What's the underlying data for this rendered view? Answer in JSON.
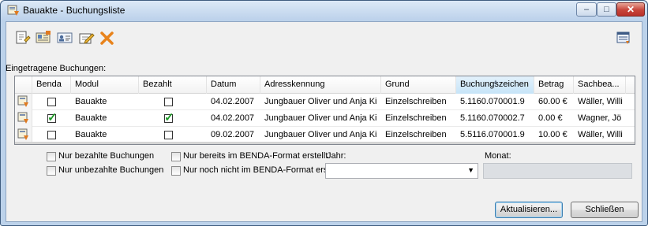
{
  "window": {
    "title": "Bauakte - Buchungsliste",
    "controls": {
      "minimize": "–",
      "maximize": "□",
      "close": "✕"
    }
  },
  "toolbar": {
    "buttons": [
      {
        "icon": "new-document-icon"
      },
      {
        "icon": "card-file-icon"
      },
      {
        "icon": "contact-card-icon"
      },
      {
        "icon": "edit-icon"
      },
      {
        "icon": "delete-x-icon"
      }
    ],
    "right_icon": "list-settings-icon"
  },
  "section_label": "Eingetragene Buchungen:",
  "table": {
    "columns": [
      "Benda",
      "Modul",
      "Bezahlt",
      "Datum",
      "Adresskennung",
      "Grund",
      "Buchungszeichen",
      "Betrag",
      "Sachbea..."
    ],
    "sorted_column": "Buchungszeichen",
    "rows": [
      {
        "benda": false,
        "modul": "Bauakte",
        "bezahlt": false,
        "datum": "04.02.2007",
        "adresse": "Jungbauer Oliver und Anja  Ki",
        "grund": "Einzelschreiben",
        "zeichen": "5.1160.070001.9",
        "betrag": "60.00 €",
        "sachbearbeiter": "Wäller, Willi"
      },
      {
        "benda": true,
        "modul": "Bauakte",
        "bezahlt": true,
        "datum": "04.02.2007",
        "adresse": "Jungbauer Oliver und Anja  Ki",
        "grund": "Einzelschreiben",
        "zeichen": "5.1160.070002.7",
        "betrag": "0.00 €",
        "sachbearbeiter": "Wagner, Jö"
      },
      {
        "benda": false,
        "modul": "Bauakte",
        "bezahlt": false,
        "datum": "09.02.2007",
        "adresse": "Jungbauer Oliver und Anja  Ki",
        "grund": "Einzelschreiben",
        "zeichen": "5.5116.070001.9",
        "betrag": "10.00 €",
        "sachbearbeiter": "Wäller, Willi"
      }
    ]
  },
  "filters": {
    "nur_bezahlte": "Nur bezahlte Buchungen",
    "nur_unbezahlte": "Nur unbezahlte Buchungen",
    "nur_benda": "Nur bereits im BENDA-Format erstellt",
    "nur_nicht_benda": "Nur noch nicht im BENDA-Format erst",
    "jahr_label": "Jahr:",
    "jahr_value": "",
    "monat_label": "Monat:",
    "monat_value": ""
  },
  "buttons": {
    "refresh": "Aktualisieren...",
    "close": "Schließen"
  },
  "colors": {
    "check_green": "#1f9b29",
    "delete_orange": "#e8831c",
    "title_bar": "#bdd2eb"
  }
}
